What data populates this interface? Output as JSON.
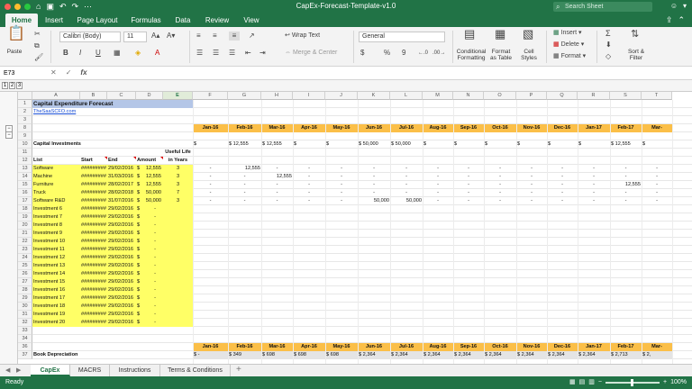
{
  "window": {
    "title": "CapEx-Forecast-Template-v1.0",
    "search_placeholder": "Search Sheet"
  },
  "ribbon_tabs": [
    "Home",
    "Insert",
    "Page Layout",
    "Formulas",
    "Data",
    "Review",
    "View"
  ],
  "ribbon": {
    "paste": "Paste",
    "font_name": "Calibri (Body)",
    "font_size": "11",
    "wrap_text": "Wrap Text",
    "merge_center": "Merge & Center",
    "number_format": "General",
    "conditional_formatting": "Conditional\nFormatting",
    "format_as_table": "Format\nas Table",
    "cell_styles": "Cell\nStyles",
    "insert": "Insert",
    "delete": "Delete",
    "format": "Format",
    "sort_filter": "Sort &\nFilter",
    "currency_symbol": "$",
    "percent_symbol": "%",
    "thousands_symbol": "9"
  },
  "formula_bar": {
    "name_box": "E73",
    "formula": ""
  },
  "outline_levels": [
    "1",
    "2",
    "3"
  ],
  "columns": [
    "A",
    "B",
    "C",
    "D",
    "E",
    "F",
    "G",
    "H",
    "I",
    "J",
    "K",
    "L",
    "M",
    "N",
    "O",
    "P",
    "Q",
    "R",
    "S",
    "T"
  ],
  "selected_column": "E",
  "months": [
    "Jan-16",
    "Feb-16",
    "Mar-16",
    "Apr-16",
    "May-16",
    "Jun-16",
    "Jul-16",
    "Aug-16",
    "Sep-16",
    "Oct-16",
    "Nov-16",
    "Dec-16",
    "Jan-17",
    "Feb-17",
    "Mar-"
  ],
  "sheet": {
    "title": "Capital Expenditure Forecast",
    "link": "TheSaaSCFO.com",
    "capex_label": "Capital Investments",
    "useful_life_header_1": "Useful Life",
    "useful_life_header_2": "in Years",
    "headers": {
      "list": "List",
      "start": "Start",
      "end": "End",
      "amount": "Amount"
    },
    "capex_totals": [
      "$",
      "$      12,555",
      "$      12,555",
      "$",
      "$",
      "$      50,000",
      "$      50,000",
      "$",
      "$",
      "$",
      "$",
      "$",
      "$",
      "$      12,555",
      "$"
    ],
    "assets": [
      {
        "name": "Software",
        "start": "#########",
        "end": "29/02/2016",
        "amount": "12,555",
        "life": "3",
        "months": [
          "-",
          "12,555",
          "-",
          "-",
          "-",
          "-",
          "-",
          "-",
          "-",
          "-",
          "-",
          "-",
          "-",
          "-",
          "-"
        ]
      },
      {
        "name": "Machine",
        "start": "#########",
        "end": "31/03/2016",
        "amount": "12,555",
        "life": "3",
        "months": [
          "-",
          "-",
          "12,555",
          "-",
          "-",
          "-",
          "-",
          "-",
          "-",
          "-",
          "-",
          "-",
          "-",
          "-",
          "-"
        ]
      },
      {
        "name": "Furniture",
        "start": "#########",
        "end": "28/02/2017",
        "amount": "12,555",
        "life": "3",
        "months": [
          "-",
          "-",
          "-",
          "-",
          "-",
          "-",
          "-",
          "-",
          "-",
          "-",
          "-",
          "-",
          "-",
          "12,555",
          "-"
        ]
      },
      {
        "name": "Truck",
        "start": "#########",
        "end": "28/02/2018",
        "amount": "50,000",
        "life": "7",
        "months": [
          "-",
          "-",
          "-",
          "-",
          "-",
          "-",
          "-",
          "-",
          "-",
          "-",
          "-",
          "-",
          "-",
          "-",
          "-"
        ]
      },
      {
        "name": "Software R&D",
        "start": "#########",
        "end": "31/07/2016",
        "amount": "50,000",
        "life": "3",
        "months": [
          "-",
          "-",
          "-",
          "-",
          "-",
          "50,000",
          "50,000",
          "-",
          "-",
          "-",
          "-",
          "-",
          "-",
          "-",
          "-"
        ]
      }
    ],
    "blank_investments": [
      "Investment 6",
      "Investment 7",
      "Investment 8",
      "Investment 9",
      "Investment 10",
      "Investment 11",
      "Investment 12",
      "Investment 13",
      "Investment 14",
      "Investment 15",
      "Investment 16",
      "Investment 17",
      "Investment 18",
      "Investment 19",
      "Investment 20"
    ],
    "blank_start": "#########",
    "blank_end": "29/02/2016",
    "blank_amount": "-",
    "depreciation_label": "Book Depreciation",
    "depreciation_values": [
      "$      -",
      "$      349",
      "$      698",
      "$      698",
      "$      698",
      "$   2,364",
      "$   2,364",
      "$   2,364",
      "$   2,364",
      "$   2,364",
      "$   2,364",
      "$   2,364",
      "$   2,364",
      "$   2,713",
      "$   2,"
    ]
  },
  "sheet_tabs": [
    "CapEx",
    "MACRS",
    "Instructions",
    "Terms & Conditions"
  ],
  "active_sheet": "CapEx",
  "status": {
    "ready": "Ready",
    "zoom": "100%"
  },
  "colors": {
    "excel_green": "#217346",
    "highlight_yellow": "#ffff66",
    "header_orange": "#fbbf48",
    "title_blue": "#b4c6e7"
  }
}
